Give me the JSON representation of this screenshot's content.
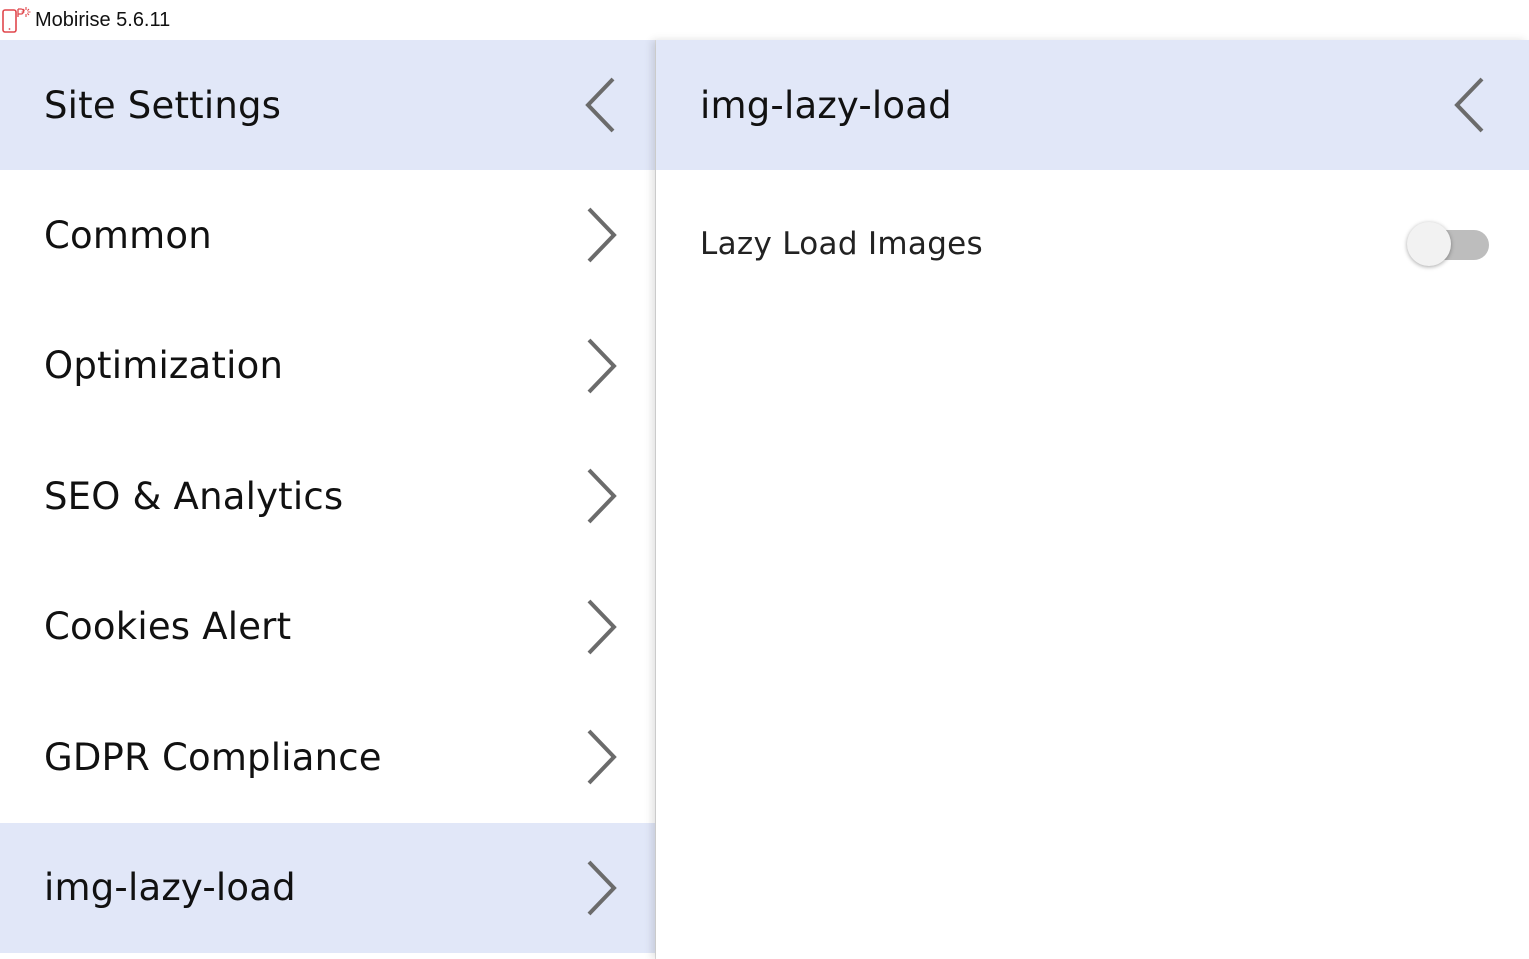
{
  "window": {
    "title": "Mobirise 5.6.11"
  },
  "left_panel": {
    "header_title": "Site Settings",
    "items": [
      {
        "label": "Common",
        "active": false
      },
      {
        "label": "Optimization",
        "active": false
      },
      {
        "label": "SEO & Analytics",
        "active": false
      },
      {
        "label": "Cookies Alert",
        "active": false
      },
      {
        "label": "GDPR Compliance",
        "active": false
      },
      {
        "label": "img-lazy-load",
        "active": true
      }
    ]
  },
  "right_panel": {
    "header_title": "img-lazy-load",
    "settings": [
      {
        "label": "Lazy Load Images",
        "enabled": false
      }
    ]
  },
  "colors": {
    "header_bg": "#e1e7f8",
    "active_item_bg": "#e1e7f8",
    "chevron": "#6b6b6b",
    "toggle_track_off": "#bdbdbd",
    "app_icon": "#e0474c"
  },
  "icons": {
    "app": "mobirise-logo-icon",
    "back": "chevron-left-icon",
    "forward": "chevron-right-icon"
  }
}
